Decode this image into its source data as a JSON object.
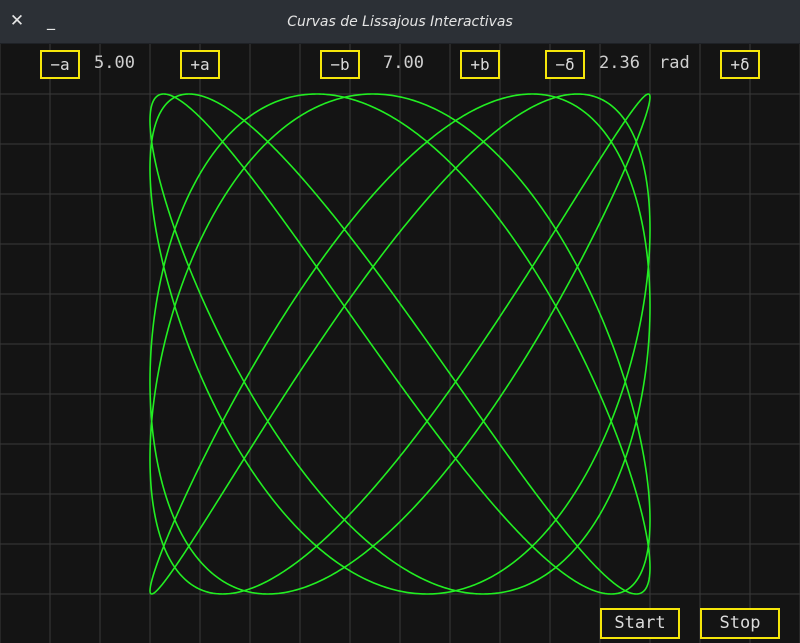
{
  "window": {
    "title": "Curvas de Lissajous Interactivas",
    "close_glyph": "✕",
    "minimize_glyph": "_"
  },
  "controls": {
    "a": {
      "dec_label": "−a",
      "value": "5.00",
      "inc_label": "+a"
    },
    "b": {
      "dec_label": "−b",
      "value": "7.00",
      "inc_label": "+b"
    },
    "delta": {
      "dec_label": "−δ",
      "value": "2.36",
      "unit": "rad",
      "inc_label": "+δ"
    }
  },
  "actions": {
    "start_label": "Start",
    "stop_label": "Stop"
  },
  "curve": {
    "a": 5.0,
    "b": 7.0,
    "delta": 2.36
  },
  "colors": {
    "background": "#141414",
    "grid": "#3a3a3a",
    "curve": "#22ee22",
    "button_border": "#f5e60a",
    "text": "#dcdcdc",
    "titlebar": "#2c3036"
  }
}
